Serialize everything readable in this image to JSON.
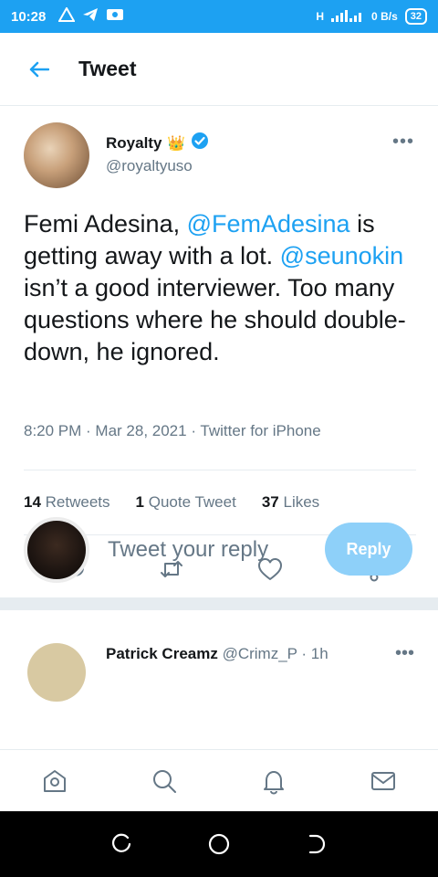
{
  "status_bar": {
    "time": "10:28",
    "battery": "32",
    "speed_top": "0",
    "speed_unit": "B/s",
    "net_label": "H"
  },
  "header": {
    "title": "Tweet",
    "back_icon": "arrow-left-icon"
  },
  "tweet": {
    "author_name": "Royalty",
    "author_emoji": "👑",
    "verified": true,
    "handle": "@royaltyuso",
    "text_parts": {
      "p1": "Femi Adesina, ",
      "m1": "@FemAdesina",
      "p2": " is getting away with a lot. ",
      "m2": "@seunokin",
      "p3": " isn’t a good interviewer. Too many questions where he should double-down, he ignored."
    },
    "time": "8:20 PM",
    "date": "Mar 28, 2021",
    "source": "Twitter for iPhone",
    "stats": {
      "retweets_count": "14",
      "retweets_label": "Retweets",
      "quotes_count": "1",
      "quotes_label": "Quote Tweet",
      "likes_count": "37",
      "likes_label": "Likes"
    }
  },
  "reply": {
    "placeholder": "Tweet your reply",
    "button_label": "Reply"
  },
  "next_tweet": {
    "name": "Patrick Creamz",
    "handle_time": "@Crimz_P · 1h"
  },
  "colors": {
    "accent": "#1da1f2",
    "muted": "#657786",
    "reply_button": "#8ed0f9"
  }
}
